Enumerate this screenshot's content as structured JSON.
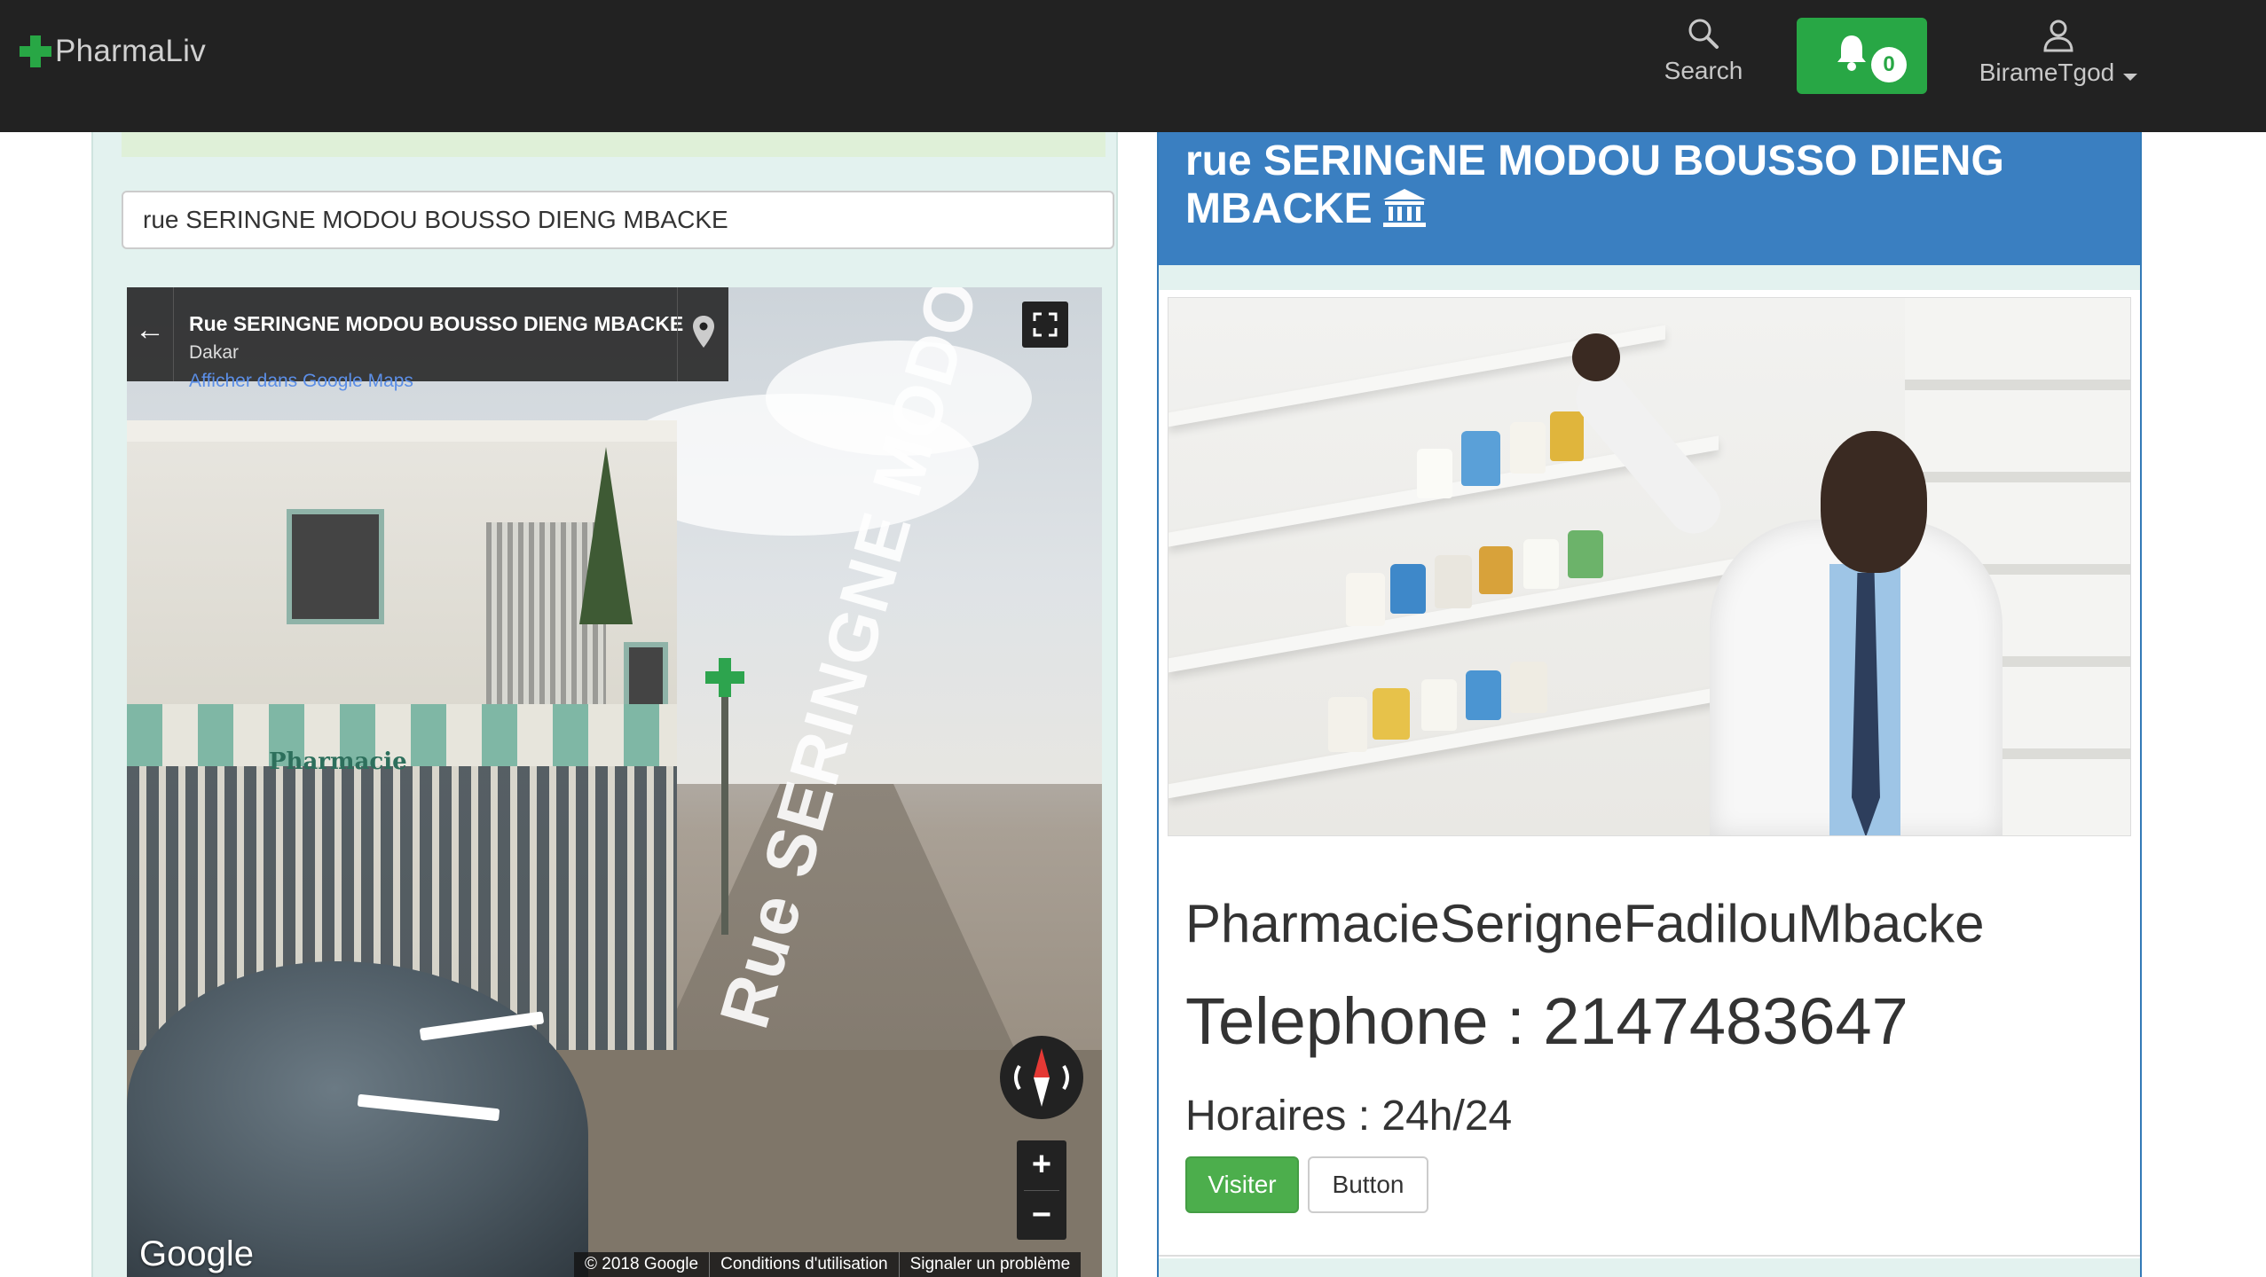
{
  "navbar": {
    "brand": "PharmaLiv",
    "search_label": "Search",
    "notifications_count": "0",
    "user_name": "BirameTgod",
    "colors": {
      "background": "#222222",
      "accent": "#28a745"
    }
  },
  "left_panel": {
    "address_value": "rue SERINGNE MODOU BOUSSO DIENG MBACKE",
    "streetview": {
      "title": "Rue SERINGNE MODOU BOUSSO DIENG MBACKE",
      "subtitle": "Dakar",
      "maps_link": "Afficher dans Google Maps",
      "sign_text": "Pharmacie",
      "street_overlay": "Rue SERINGNE MODOU DIENG",
      "google_logo": "Google",
      "footer": [
        "© 2018 Google",
        "Conditions d'utilisation",
        "Signaler un problème"
      ],
      "zoom_in": "+",
      "zoom_out": "−",
      "back_arrow": "←"
    }
  },
  "right_card": {
    "header_title": "rue SERINGNE MODOU BOUSSO DIENG MBACKE",
    "header_icon": "bank-icon",
    "header_color": "#3a7fc1",
    "pharmacy_name": "PharmacieSerigneFadilouMbacke",
    "phone": "Telephone : 2147483647",
    "hours": "Horaires : 24h/24",
    "buttons": {
      "visit": "Visiter",
      "secondary": "Button"
    }
  }
}
